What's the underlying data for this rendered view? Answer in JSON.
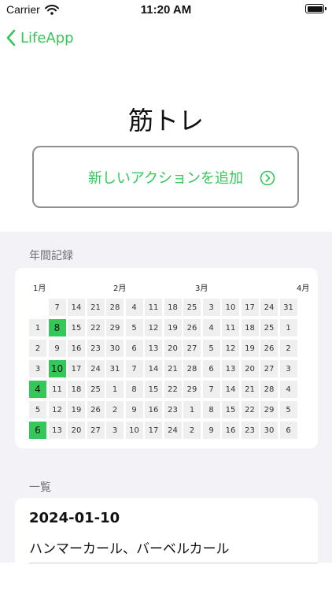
{
  "status_bar": {
    "carrier": "Carrier",
    "time": "11:20 AM"
  },
  "nav": {
    "back_label": "LifeApp"
  },
  "title": "筋トレ",
  "add_action": {
    "label": "新しいアクションを追加"
  },
  "calendar": {
    "section_title": "年間記録",
    "months": [
      "1月",
      "2月",
      "3月",
      "4月"
    ],
    "columns": [
      [
        "",
        "1",
        "2",
        "3",
        "4",
        "5",
        "6"
      ],
      [
        "7",
        "8",
        "9",
        "10",
        "11",
        "12",
        "13"
      ],
      [
        "14",
        "15",
        "16",
        "17",
        "18",
        "19",
        "20"
      ],
      [
        "21",
        "22",
        "23",
        "24",
        "25",
        "26",
        "27"
      ],
      [
        "28",
        "29",
        "30",
        "31",
        "1",
        "2",
        "3"
      ],
      [
        "4",
        "5",
        "6",
        "7",
        "8",
        "9",
        "10"
      ],
      [
        "11",
        "12",
        "13",
        "14",
        "15",
        "16",
        "17"
      ],
      [
        "18",
        "19",
        "20",
        "21",
        "22",
        "23",
        "24"
      ],
      [
        "25",
        "26",
        "27",
        "28",
        "29",
        "1",
        "2"
      ],
      [
        "3",
        "4",
        "5",
        "6",
        "7",
        "8",
        "9"
      ],
      [
        "10",
        "11",
        "12",
        "13",
        "14",
        "15",
        "16"
      ],
      [
        "17",
        "18",
        "19",
        "20",
        "21",
        "22",
        "23"
      ],
      [
        "24",
        "25",
        "26",
        "27",
        "28",
        "29",
        "30"
      ],
      [
        "31",
        "1",
        "2",
        "3",
        "4",
        "5",
        "6"
      ]
    ],
    "active_dates": [
      "2024-01-04",
      "2024-01-06",
      "2024-01-08",
      "2024-01-10"
    ],
    "accent_color": "#34c759"
  },
  "list": {
    "section_title": "一覧",
    "entries": [
      {
        "date": "2024-01-10",
        "items": "ハンマーカール、バーベルカール"
      }
    ]
  },
  "colors": {
    "accent": "#34c759",
    "border": "#8e8e93",
    "group_background": "#f2f2f7"
  },
  "icons": {
    "back": "chevron-left-icon",
    "add": "chevron-right-circle-icon",
    "wifi": "wifi-icon",
    "battery": "battery-icon"
  }
}
